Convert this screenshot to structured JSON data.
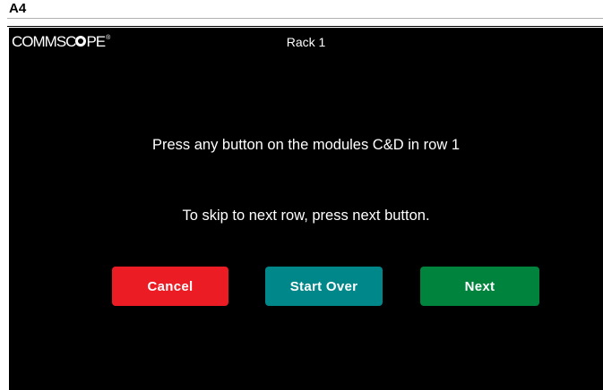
{
  "page": {
    "label": "A4"
  },
  "header": {
    "logo_prefix": "COMMSC",
    "logo_suffix": "PE",
    "logo_reg": "®",
    "title": "Rack 1"
  },
  "main": {
    "instruction": "Press any button on the modules C&D in row 1",
    "skip_hint": "To skip to next row, press next button."
  },
  "buttons": {
    "cancel_label": "Cancel",
    "start_over_label": "Start Over",
    "next_label": "Next"
  },
  "colors": {
    "screen_background": "#000000",
    "cancel": "#ec1c24",
    "start_over": "#00878a",
    "next": "#00843d"
  }
}
